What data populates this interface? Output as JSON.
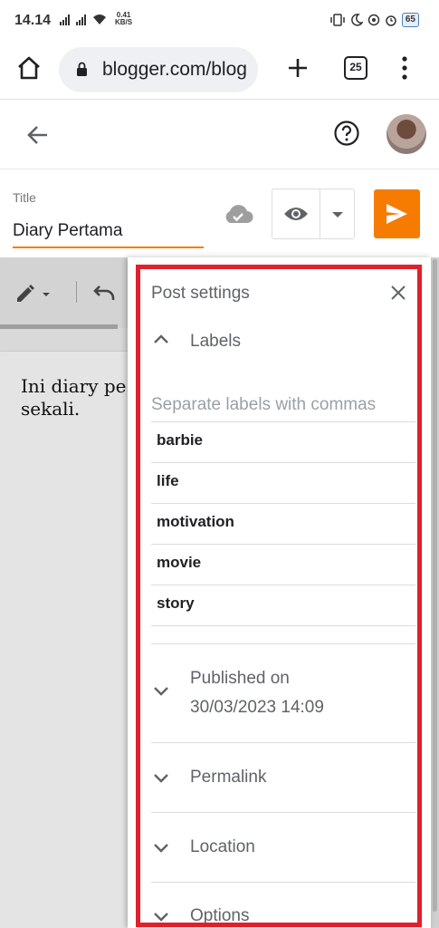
{
  "status_bar": {
    "time": "14.14",
    "net_speed_value": "0.41",
    "net_speed_unit": "KB/S",
    "battery": "65"
  },
  "browser": {
    "url": "blogger.com/blog",
    "tab_count": "25"
  },
  "editor": {
    "title_label": "Title",
    "title_value": "Diary Pertama",
    "body_line1": "Ini diary pe",
    "body_line2": "sekali."
  },
  "post_settings": {
    "header": "Post settings",
    "labels_section": "Labels",
    "labels_placeholder": "Separate labels with commas",
    "labels": [
      "barbie",
      "life",
      "motivation",
      "movie",
      "story"
    ],
    "published_label": "Published on",
    "published_value": "30/03/2023 14:09",
    "permalink_label": "Permalink",
    "location_label": "Location",
    "options_label": "Options"
  },
  "colors": {
    "accent": "#f57c00",
    "highlight": "#e0202a"
  }
}
